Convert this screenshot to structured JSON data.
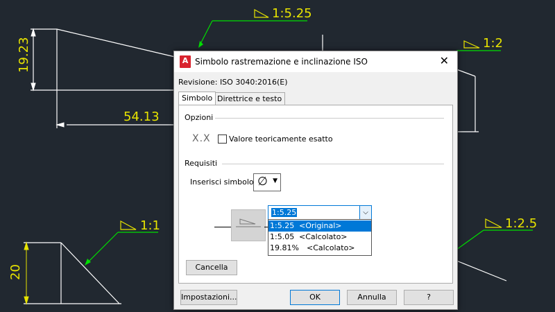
{
  "drawing": {
    "labels": {
      "top_taper": "1:5.25",
      "right_taper_top": "1:2",
      "dim_vertical_top": "19.23",
      "dim_horizontal": "54.13",
      "left_slope": "1:1",
      "right_taper_bottom": "1:2.5",
      "dim_vertical_bottom": "20"
    },
    "colors": {
      "background": "#212830",
      "annotation": "#e8e400",
      "leader": "#00e000",
      "geometry": "#ffffff"
    }
  },
  "dialog": {
    "title": "Simbolo rastremazione e inclinazione ISO",
    "revision": "Revisione: ISO 3040:2016(E)",
    "tabs": [
      "Simbolo",
      "Direttrice e testo"
    ],
    "options_label": "Opzioni",
    "xx_text": "X.X",
    "exact_checkbox": {
      "label": "Valore teoricamente esatto",
      "checked": false
    },
    "requirements_label": "Requisiti",
    "insert_symbol_label": "Inserisci simbolo:",
    "symbol_value": "∅",
    "ratio_combo": {
      "value": "1:5.25",
      "options": [
        {
          "value": "1:5.25",
          "note": "<Original>"
        },
        {
          "value": "1:5.05",
          "note": "<Calcolato>"
        },
        {
          "value": "19.81%",
          "note": "<Calcolato>"
        }
      ]
    },
    "buttons": {
      "delete": "Cancella",
      "settings": "Impostazioni...",
      "ok": "OK",
      "cancel": "Annulla",
      "help": "?"
    }
  }
}
